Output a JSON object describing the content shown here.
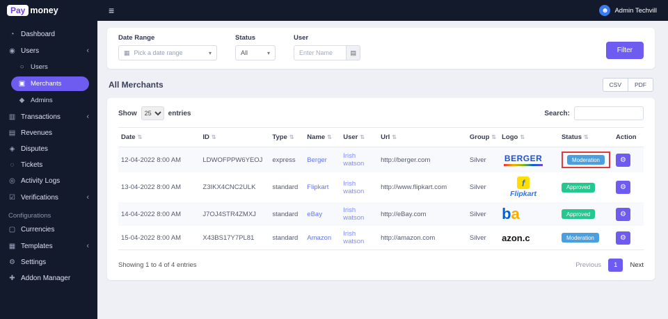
{
  "colors": {
    "accent": "#6e5bf0",
    "topbar_bg": "#131a2c",
    "sidebar_bg": "#131a2c",
    "badge_moderation": "#4a9fe0",
    "badge_approved": "#24c78e",
    "highlight_red": "#e03a3a",
    "link": "#6577f0"
  },
  "brand": {
    "logo_pay": "Pay",
    "logo_money": "money",
    "menu_icon": "≡"
  },
  "topbar": {
    "user_name": "Admin Techvill",
    "avatar_icon": "☻"
  },
  "sidebar": {
    "items": [
      {
        "label": "Dashboard",
        "icon": "◔"
      },
      {
        "label": "Users",
        "icon": "◉",
        "chevron": "‹"
      },
      {
        "label": "Users",
        "icon": "○"
      },
      {
        "label": "Merchants",
        "icon": "▣"
      },
      {
        "label": "Admins",
        "icon": "◆"
      },
      {
        "label": "Transactions",
        "icon": "▥",
        "chevron": "‹"
      },
      {
        "label": "Revenues",
        "icon": "▤"
      },
      {
        "label": "Disputes",
        "icon": "◈"
      },
      {
        "label": "Tickets",
        "icon": "◌"
      },
      {
        "label": "Activity Logs",
        "icon": "◎"
      },
      {
        "label": "Verifications",
        "icon": "☑",
        "chevron": "‹"
      },
      {
        "label": "Configurations"
      },
      {
        "label": "Currencies",
        "icon": "▢"
      },
      {
        "label": "Templates",
        "icon": "▦",
        "chevron": "‹"
      },
      {
        "label": "Settings",
        "icon": "⚙"
      },
      {
        "label": "Addon Manager",
        "icon": "✚"
      }
    ]
  },
  "filters": {
    "date_label": "Date Range",
    "date_placeholder": "Pick a date range",
    "date_icon": "▦",
    "caret": "▾",
    "status_label": "Status",
    "status_value": "All",
    "user_label": "User",
    "user_placeholder": "Enter Name",
    "user_icon": "▤",
    "filter_button": "Filter"
  },
  "page_title": "All Merchants",
  "export": {
    "csv": "CSV",
    "pdf": "PDF"
  },
  "table": {
    "show_label": "Show",
    "page_size": "25",
    "entries_label": "entries",
    "search_label": "Search:",
    "sort_icon": "⇅",
    "columns": [
      "Date",
      "ID",
      "Type",
      "Name",
      "User",
      "Url",
      "Group",
      "Logo",
      "Status",
      "Action"
    ],
    "action_icon": "⚙",
    "rows": [
      {
        "date": "12-04-2022 8:00 AM",
        "id": "LDWOFPPW6YEOJ",
        "type": "express",
        "name": "Berger",
        "user": "Irish watson",
        "url": "http://berger.com",
        "group": "Silver",
        "logo": {
          "name": "berger-logo",
          "text": "BERGER"
        },
        "status": "Moderation"
      },
      {
        "date": "13-04-2022 8:00 AM",
        "id": "Z3IKX4CNC2ULK",
        "type": "standard",
        "name": "Flipkart",
        "user": "Irish watson",
        "url": "http://www.flipkart.com",
        "group": "Silver",
        "logo": {
          "name": "flipkart-logo",
          "f": "f",
          "text": "Flipkart"
        },
        "status": "Approved"
      },
      {
        "date": "14-04-2022 8:00 AM",
        "id": "J7OJ4STR4ZMXJ",
        "type": "standard",
        "name": "eBay",
        "user": "Irish watson",
        "url": "http://eBay.com",
        "group": "Silver",
        "logo": {
          "name": "ebay-logo",
          "b": "b",
          "a": "a"
        },
        "status": "Approved"
      },
      {
        "date": "15-04-2022 8:00 AM",
        "id": "X43BS17Y7PL81",
        "type": "standard",
        "name": "Amazon",
        "user": "Irish watson",
        "url": "http://amazon.com",
        "group": "Silver",
        "logo": {
          "name": "amazon-logo",
          "text": "azon.c"
        },
        "status": "Moderation"
      }
    ],
    "footer_text": "Showing 1 to 4 of 4 entries",
    "pagination": {
      "previous": "Previous",
      "current": "1",
      "next": "Next"
    }
  }
}
